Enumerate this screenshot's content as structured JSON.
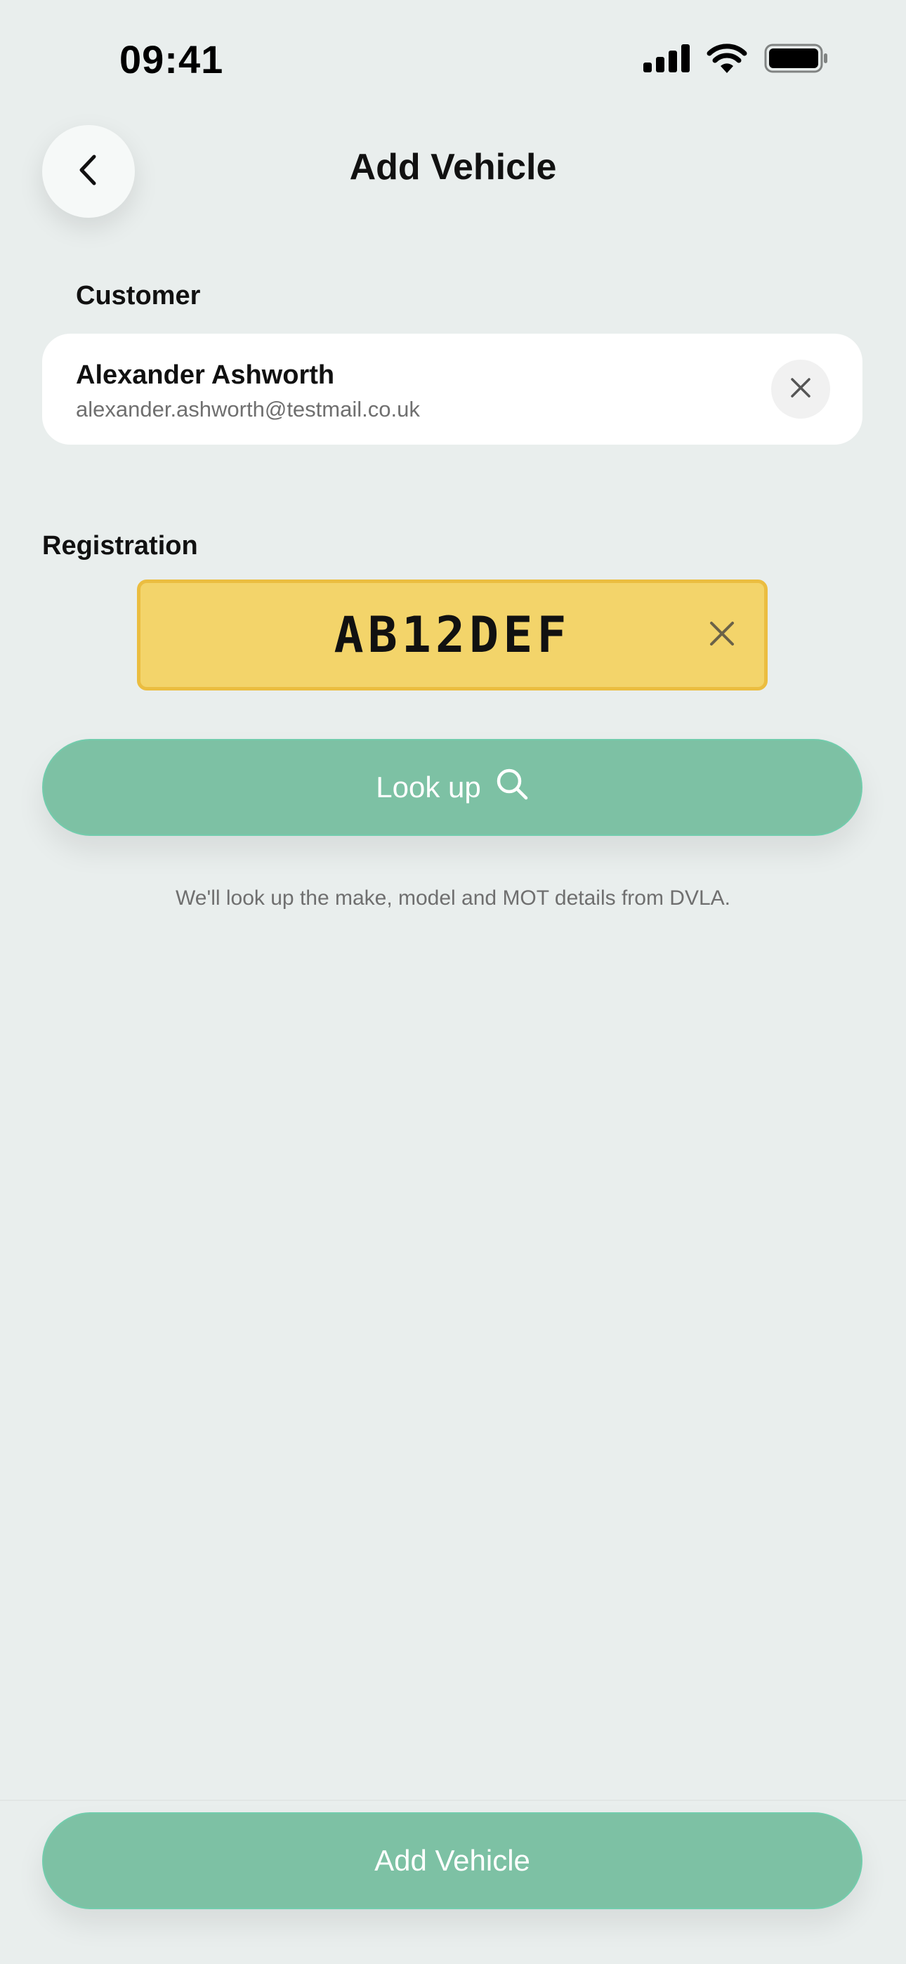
{
  "status_bar": {
    "time": "09:41",
    "icons": [
      "signal-icon",
      "wifi-icon",
      "battery-icon"
    ]
  },
  "header": {
    "title": "Add Vehicle",
    "back_icon": "chevron-left-icon"
  },
  "customer": {
    "label": "Customer",
    "name": "Alexander Ashworth",
    "email": "alexander.ashworth@testmail.co.uk",
    "clear_icon": "close-icon"
  },
  "registration": {
    "label": "Registration",
    "value": "AB12DEF",
    "clear_icon": "close-icon"
  },
  "lookup": {
    "label": "Look up",
    "icon": "search-icon",
    "helper": "We'll look up the make, model and MOT details from DVLA."
  },
  "footer": {
    "submit_label": "Add Vehicle"
  },
  "colors": {
    "background": "#e9eeed",
    "accent": "#7dc1a4",
    "plate": "#f3d46a",
    "plate_border": "#ebbd40"
  }
}
